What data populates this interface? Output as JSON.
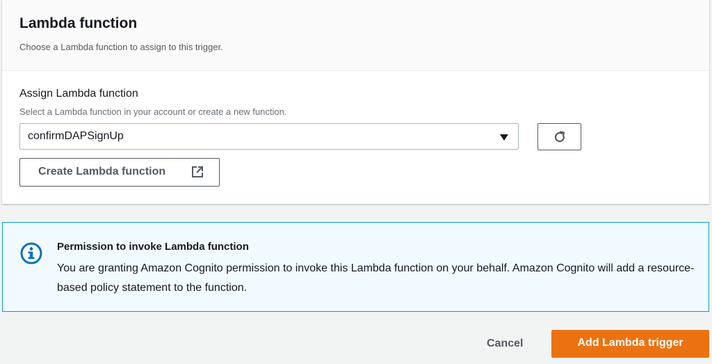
{
  "panel": {
    "title": "Lambda function",
    "description": "Choose a Lambda function to assign to this trigger."
  },
  "field": {
    "label": "Assign Lambda function",
    "description": "Select a Lambda function in your account or create a new function.",
    "selected_value": "confirmDAPSignUp"
  },
  "buttons": {
    "create_label": "Create Lambda function",
    "cancel_label": "Cancel",
    "add_label": "Add Lambda trigger"
  },
  "alert": {
    "title": "Permission to invoke Lambda function",
    "body": "You are granting Amazon Cognito permission to invoke this Lambda function on your behalf. Amazon Cognito will add a resource-based policy statement to the function."
  },
  "icons": {
    "dropdown": "caret-down-icon",
    "refresh": "refresh-icon",
    "external": "external-link-icon",
    "info": "info-icon"
  },
  "colors": {
    "primary": "#ec7211",
    "info_border": "#00a1c9",
    "info_bg": "#f1faff",
    "info_icon": "#0073bb"
  }
}
